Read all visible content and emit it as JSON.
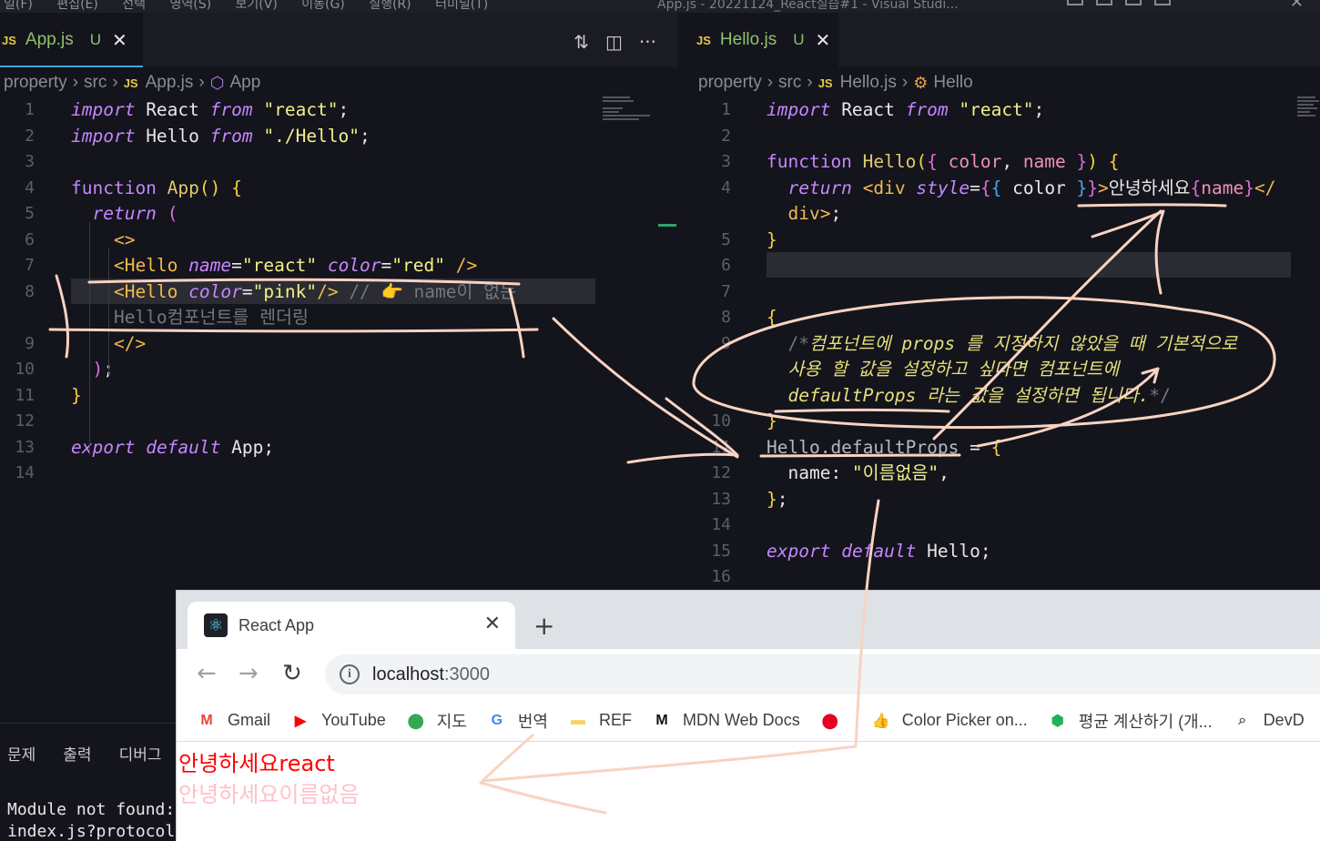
{
  "menubar": {
    "menus": "일(F) 편집(E) 선택 영역(S) 보기(V) 이동(G) 실행(R) 터미널(T)",
    "window_title": "App.js - 20221124_React실습#1 - Visual Studi..."
  },
  "left": {
    "tab": {
      "filename": "App.js",
      "status": "U",
      "lang": "JS"
    },
    "breadcrumb": [
      "property",
      "src",
      "App.js",
      "App"
    ],
    "lines": [
      {
        "n": "1",
        "segs": [
          [
            "k",
            "import"
          ],
          [
            "p",
            " React "
          ],
          [
            "k",
            "from"
          ],
          [
            "p",
            " "
          ],
          [
            "s",
            "\"react\""
          ],
          [
            "p",
            ";"
          ]
        ]
      },
      {
        "n": "2",
        "segs": [
          [
            "k",
            "import"
          ],
          [
            "p",
            " Hello "
          ],
          [
            "k",
            "from"
          ],
          [
            "p",
            " "
          ],
          [
            "s",
            "\"./Hello\""
          ],
          [
            "p",
            ";"
          ]
        ]
      },
      {
        "n": "3",
        "segs": []
      },
      {
        "n": "4",
        "segs": [
          [
            "k2",
            "function"
          ],
          [
            "p",
            " "
          ],
          [
            "fn",
            "App"
          ],
          [
            "br1",
            "()"
          ],
          [
            "p",
            " "
          ],
          [
            "br1",
            "{"
          ]
        ]
      },
      {
        "n": "5",
        "segs": [
          [
            "p",
            "  "
          ],
          [
            "k",
            "return"
          ],
          [
            "p",
            " "
          ],
          [
            "br2",
            "("
          ]
        ]
      },
      {
        "n": "6",
        "segs": [
          [
            "p",
            "    "
          ],
          [
            "tg",
            "<>"
          ]
        ]
      },
      {
        "n": "7",
        "segs": [
          [
            "p",
            "    "
          ],
          [
            "tg",
            "<Hello"
          ],
          [
            "p",
            " "
          ],
          [
            "at",
            "name"
          ],
          [
            "p",
            "="
          ],
          [
            "s",
            "\"react\""
          ],
          [
            "p",
            " "
          ],
          [
            "at",
            "color"
          ],
          [
            "p",
            "="
          ],
          [
            "s",
            "\"red\""
          ],
          [
            "p",
            " "
          ],
          [
            "tg",
            "/>"
          ]
        ]
      },
      {
        "n": "8",
        "segs": [
          [
            "p",
            "    "
          ],
          [
            "tg",
            "<Hello"
          ],
          [
            "p",
            " "
          ],
          [
            "at",
            "color"
          ],
          [
            "p",
            "="
          ],
          [
            "s",
            "\"pink\""
          ],
          [
            "tg",
            "/>"
          ],
          [
            "p",
            " "
          ],
          [
            "cm",
            "// 👉 name이 없는"
          ]
        ]
      },
      {
        "n": "",
        "segs": [
          [
            "p",
            "    "
          ],
          [
            "cm",
            "Hello컴포넌트를 렌더링"
          ]
        ]
      },
      {
        "n": "9",
        "segs": [
          [
            "p",
            "    "
          ],
          [
            "tg",
            "</>"
          ]
        ]
      },
      {
        "n": "10",
        "segs": [
          [
            "p",
            "  "
          ],
          [
            "br2",
            ")"
          ],
          [
            "p",
            ";"
          ]
        ]
      },
      {
        "n": "11",
        "segs": [
          [
            "br1",
            "}"
          ]
        ]
      },
      {
        "n": "12",
        "segs": []
      },
      {
        "n": "13",
        "segs": [
          [
            "k",
            "export"
          ],
          [
            "p",
            " "
          ],
          [
            "k",
            "default"
          ],
          [
            "p",
            " App;"
          ]
        ]
      },
      {
        "n": "14",
        "segs": []
      }
    ]
  },
  "right": {
    "tab": {
      "filename": "Hello.js",
      "status": "U",
      "lang": "JS"
    },
    "breadcrumb": [
      "property",
      "src",
      "Hello.js",
      "Hello"
    ],
    "lines": [
      {
        "n": "1",
        "segs": [
          [
            "k",
            "import"
          ],
          [
            "p",
            " React "
          ],
          [
            "k",
            "from"
          ],
          [
            "p",
            " "
          ],
          [
            "s",
            "\"react\""
          ],
          [
            "p",
            ";"
          ]
        ]
      },
      {
        "n": "2",
        "segs": []
      },
      {
        "n": "3",
        "segs": [
          [
            "k2",
            "function"
          ],
          [
            "p",
            " "
          ],
          [
            "fn",
            "Hello"
          ],
          [
            "br1",
            "("
          ],
          [
            "br2",
            "{"
          ],
          [
            "pr",
            " color"
          ],
          [
            "p",
            ", "
          ],
          [
            "pr",
            "name"
          ],
          [
            "br2",
            " }"
          ],
          [
            "br1",
            ")"
          ],
          [
            "p",
            " "
          ],
          [
            "br1",
            "{"
          ]
        ]
      },
      {
        "n": "4",
        "segs": [
          [
            "p",
            "  "
          ],
          [
            "k",
            "return"
          ],
          [
            "p",
            " "
          ],
          [
            "tg",
            "<div"
          ],
          [
            "p",
            " "
          ],
          [
            "at",
            "style"
          ],
          [
            "p",
            "="
          ],
          [
            "br2",
            "{"
          ],
          [
            "br3",
            "{"
          ],
          [
            "p",
            " color "
          ],
          [
            "br3",
            "}"
          ],
          [
            "br2",
            "}"
          ],
          [
            "tg",
            ">"
          ],
          [
            "jsx",
            "안녕하세요"
          ],
          [
            "br2",
            "{"
          ],
          [
            "pr",
            "name"
          ],
          [
            "br2",
            "}"
          ],
          [
            "tg",
            "</"
          ]
        ]
      },
      {
        "n": "",
        "segs": [
          [
            "p",
            "  "
          ],
          [
            "tg",
            "div"
          ],
          [
            "tg",
            ">"
          ],
          [
            "p",
            ";"
          ]
        ]
      },
      {
        "n": "5",
        "segs": [
          [
            "br1",
            "}"
          ]
        ]
      },
      {
        "n": "6",
        "segs": []
      },
      {
        "n": "7",
        "segs": []
      },
      {
        "n": "8",
        "segs": [
          [
            "br1",
            "{"
          ]
        ]
      },
      {
        "n": "9",
        "segs": [
          [
            "p",
            "  "
          ],
          [
            "cm",
            "/*"
          ],
          [
            "cmi",
            "컴포넌트에 props 를 지정하지 않았을 때 기본적으로"
          ]
        ]
      },
      {
        "n": "",
        "segs": [
          [
            "p",
            "  "
          ],
          [
            "cmi",
            "사용 할 값을 설정하고 싶다면 컴포넌트에"
          ]
        ]
      },
      {
        "n": "",
        "segs": [
          [
            "p",
            "  "
          ],
          [
            "cmi",
            "defaultProps 라는 값을 설정하면 됩니다."
          ],
          [
            "cm",
            "*/"
          ]
        ]
      },
      {
        "n": "10",
        "segs": [
          [
            "br1",
            "}"
          ]
        ]
      },
      {
        "n": "11",
        "segs": [
          [
            "id",
            "Hello.defaultProps"
          ],
          [
            "p",
            " = "
          ],
          [
            "br1",
            "{"
          ]
        ]
      },
      {
        "n": "12",
        "segs": [
          [
            "p",
            "  name: "
          ],
          [
            "s",
            "\"이름없음\""
          ],
          [
            "p",
            ","
          ]
        ]
      },
      {
        "n": "13",
        "segs": [
          [
            "br1",
            "}"
          ],
          [
            "p",
            ";"
          ]
        ]
      },
      {
        "n": "14",
        "segs": []
      },
      {
        "n": "15",
        "segs": [
          [
            "k",
            "export"
          ],
          [
            "p",
            " "
          ],
          [
            "k",
            "default"
          ],
          [
            "p",
            " Hello;"
          ]
        ]
      },
      {
        "n": "16",
        "segs": []
      }
    ]
  },
  "panel": {
    "tabs": [
      "문제",
      "출력",
      "디버그"
    ],
    "lines": [
      "Module not found: E",
      "index.js?protocol=w"
    ]
  },
  "browser": {
    "tab_title": "React App",
    "url_host": "localhost",
    "url_port": ":3000",
    "bookmarks": [
      {
        "label": "Gmail",
        "icon": "gmail-icon",
        "glyph": "M",
        "color": "#ea4335"
      },
      {
        "label": "YouTube",
        "icon": "youtube-icon",
        "glyph": "▶",
        "color": "#ff0000"
      },
      {
        "label": "지도",
        "icon": "maps-icon",
        "glyph": "⬤",
        "color": "#34a853"
      },
      {
        "label": "번역",
        "icon": "translate-icon",
        "glyph": "G",
        "color": "#4285f4"
      },
      {
        "label": "REF",
        "icon": "folder-icon",
        "glyph": "▬",
        "color": "#f6d365"
      },
      {
        "label": "MDN Web Docs",
        "icon": "mdn-icon",
        "glyph": "M",
        "color": "#111111"
      },
      {
        "label": "",
        "icon": "pinterest-icon",
        "glyph": "⬤",
        "color": "#e60023"
      },
      {
        "label": "Color Picker on...",
        "icon": "hand-icon",
        "glyph": "👍",
        "color": "#f4b400"
      },
      {
        "label": "평균 계산하기 (개...",
        "icon": "shield-check-icon",
        "glyph": "⬢",
        "color": "#20b15a"
      },
      {
        "label": "DevD",
        "icon": "search-box-icon",
        "glyph": "⌕",
        "color": "#5f6368"
      }
    ],
    "output": [
      {
        "text": "안녕하세요react",
        "color": "#ff0000"
      },
      {
        "text": "안녕하세요이름없음",
        "color": "#ffc0cb"
      }
    ]
  },
  "colors": {
    "accent_tab": "#3aa6d8",
    "modified": "#8fc16b",
    "annotation": "#f8d3c2"
  }
}
